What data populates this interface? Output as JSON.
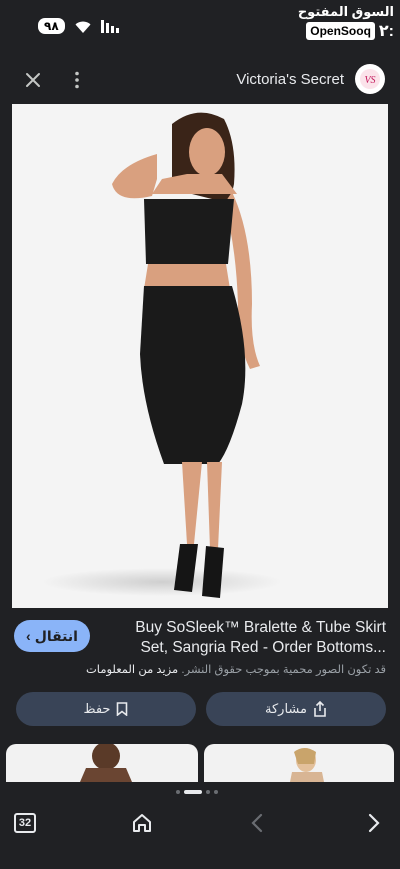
{
  "status_bar": {
    "battery": "٩٨",
    "time": "٢:",
    "brand_ar": "السوق المفتوح",
    "brand_en": "OpenSooq"
  },
  "header": {
    "site_name": "Victoria's Secret",
    "logo_text": "VS",
    "icons": [
      "close-icon",
      "more-vert-icon"
    ]
  },
  "result": {
    "title": "Buy SoSleek™ Bralette & Tube Skirt Set, Sangria Red - Order Bottoms...",
    "disclaimer": "قد تكون الصور محمية بموجب حقوق النشر.",
    "learn_more": "مزيد من المعلومات",
    "go_button": "انتقال"
  },
  "actions": {
    "share_label": "مشاركة",
    "save_label": "حفظ"
  },
  "bottom_nav": {
    "tabs_count": "32"
  },
  "colors": {
    "background": "#202124",
    "accent": "#8ab4f8",
    "button": "#394457"
  }
}
